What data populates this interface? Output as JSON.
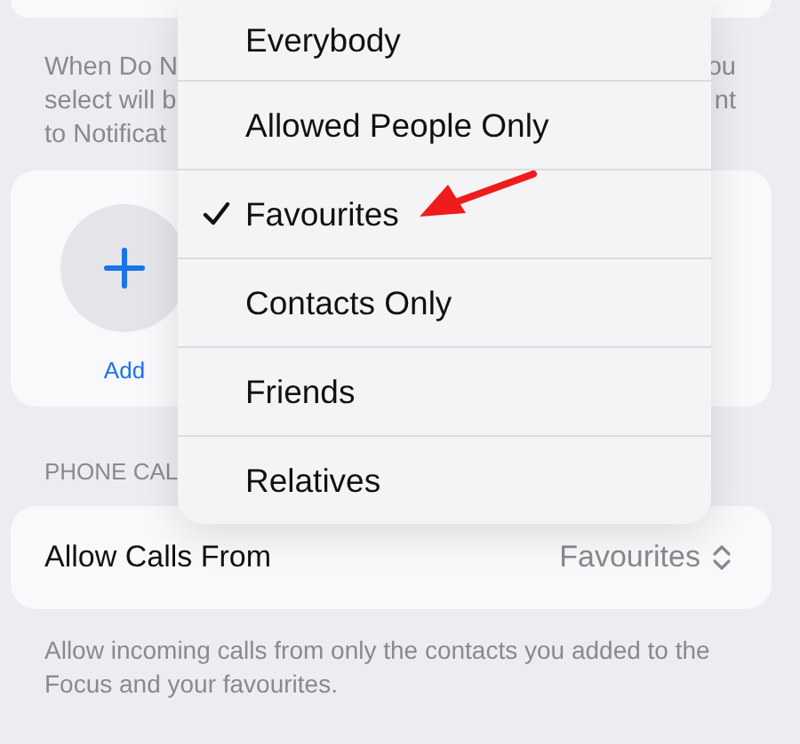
{
  "top_note": {
    "left_lines": [
      "When Do N",
      "select will b",
      "to Notificat"
    ],
    "right_lines": [
      "ou",
      "nt"
    ]
  },
  "people": {
    "add_label": "Add"
  },
  "section_header": "PHONE CAL",
  "allow_calls": {
    "label": "Allow Calls From",
    "value": "Favourites"
  },
  "footer": "Allow incoming calls from only the contacts you added to the Focus and your favourites.",
  "menu": {
    "items": [
      {
        "label": "Everybody",
        "selected": false
      },
      {
        "label": "Allowed People Only",
        "selected": false
      },
      {
        "label": "Favourites",
        "selected": true
      },
      {
        "label": "Contacts Only",
        "selected": false
      },
      {
        "label": "Friends",
        "selected": false
      },
      {
        "label": "Relatives",
        "selected": false
      }
    ]
  },
  "annotation": {
    "kind": "arrow"
  }
}
